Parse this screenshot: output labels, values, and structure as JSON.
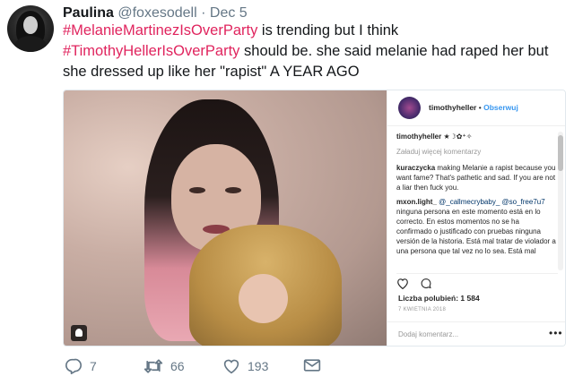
{
  "tweet": {
    "author_name": "Paulina",
    "handle": "@foxesodell",
    "separator": "·",
    "date": "Dec 5",
    "text": {
      "hashtag1": "#MelanieMartinezIsOverParty",
      "part1": " is trending but I think ",
      "hashtag2": "#TimothyHellerIsOverParty",
      "part2": " should be. she said melanie had raped her but she dressed up like her \"rapist\" A YEAR AGO"
    },
    "actions": {
      "reply_count": "7",
      "retweet_count": "66",
      "like_count": "193"
    }
  },
  "instagram": {
    "username": "timothyheller",
    "separator": "•",
    "follow_label": "Obserwuj",
    "caption_user": "timothyheller ★☽✿⁺✧",
    "load_more": "Załaduj więcej komentarzy",
    "comments": [
      {
        "user": "kuraczycka",
        "text": " making Melanie a rapist because you want fame? That's pathetic and sad. If you are not a liar then fuck you."
      },
      {
        "user": "mxon.light_",
        "mention1": "@_callmecrybaby_",
        "mention2": "@so_free7u7",
        "text": " ninguna persona en este momento está en lo correcto. En estos momentos no se ha confirmado o justificado con pruebas ninguna versión de la historia. Está mal tratar de violador a una persona que tal vez no lo sea. Está mal"
      }
    ],
    "likes": "Liczba polubień: 1 584",
    "date": "7 KWIETNIA 2018",
    "add_comment_placeholder": "Dodaj komentarz...",
    "more_label": "•••",
    "icons": [
      "heart-icon",
      "comment-bubble-icon",
      "user-tag-icon"
    ]
  },
  "colors": {
    "hashtag": "#e0245e",
    "muted": "#657786",
    "link": "#3897f0"
  }
}
